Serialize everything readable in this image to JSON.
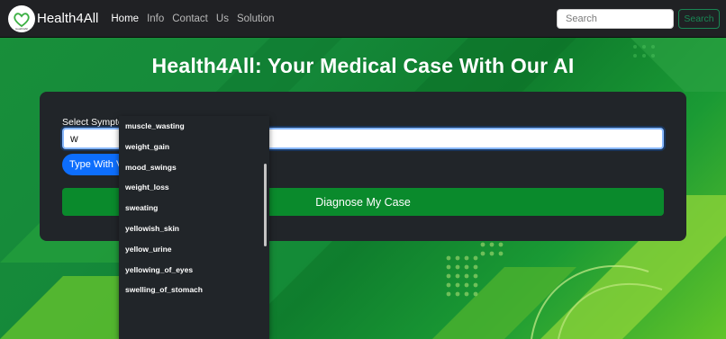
{
  "navbar": {
    "brand": "Health4All",
    "logo_text": "Health4All",
    "links": [
      "Home",
      "Info",
      "Contact",
      "Us",
      "Solution"
    ],
    "search_placeholder": "Search",
    "search_button": "Search"
  },
  "hero": {
    "title": "Health4All: Your Medical Case With Our AI"
  },
  "form": {
    "label": "Select Symptoms:",
    "input_value": "w",
    "voice_button": "Type With Voice",
    "diagnose_button": "Diagnose My Case"
  },
  "dropdown": {
    "items": [
      "muscle_wasting",
      "weight_gain",
      "mood_swings",
      "weight_loss",
      "sweating",
      "yellowish_skin",
      "yellow_urine",
      "yellowing_of_eyes",
      "swelling_of_stomach"
    ]
  },
  "colors": {
    "navbar_bg": "#202124",
    "card_bg": "#212529",
    "primary": "#0d6efd",
    "success": "#198754",
    "diagnose": "#0a8a2c"
  }
}
